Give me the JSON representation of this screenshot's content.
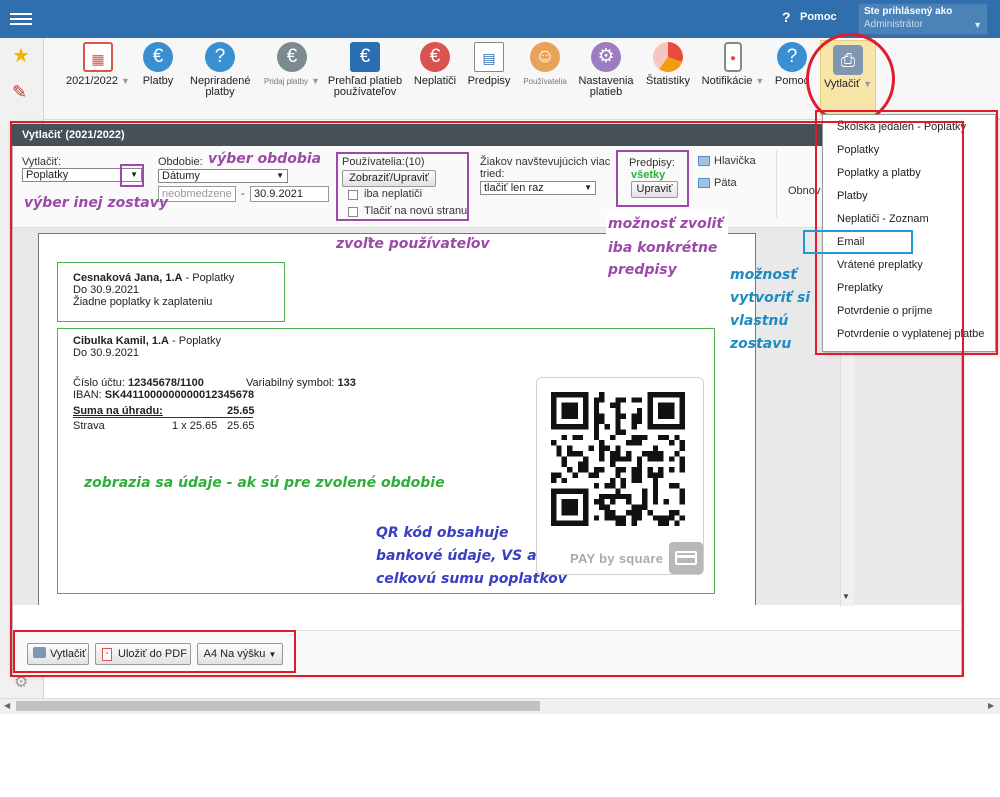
{
  "topbar": {
    "help": "Pomoc",
    "user_line1": "Ste prihlásený ako",
    "user_line2": "Administrátor"
  },
  "toolbar": {
    "items": [
      {
        "label": "2021/2022",
        "icon": "calendar-icon",
        "dropdown": true
      },
      {
        "label": "Platby",
        "icon": "money-bag-icon"
      },
      {
        "label": "Nepriradené platby",
        "icon": "question-money-bag-icon"
      },
      {
        "label": "Pridaj platby",
        "icon": "add-money-bag-icon",
        "dropdown": true
      },
      {
        "label": "Prehľad platieb používateľov",
        "icon": "ledger-icon"
      },
      {
        "label": "Neplatiči",
        "icon": "debtor-icon"
      },
      {
        "label": "Predpisy",
        "icon": "document-icon"
      },
      {
        "label": "Používatelia",
        "icon": "user-icon"
      },
      {
        "label": "Nastavenia platieb",
        "icon": "settings-gear-icon"
      },
      {
        "label": "Štatistiky",
        "icon": "pie-chart-icon"
      },
      {
        "label": "Notifikácie",
        "icon": "phone-icon",
        "dropdown": true
      },
      {
        "label": "Pomoc",
        "icon": "help-icon"
      },
      {
        "label": "Vytlačiť",
        "icon": "printer-icon",
        "dropdown": true
      }
    ]
  },
  "modal": {
    "title": "Vytlačiť (2021/2022)",
    "print_label": "Vytlačiť:",
    "print_value": "Poplatky",
    "period_label": "Obdobie:",
    "period_value": "Dátumy",
    "date_from_placeholder": "neobmedzene",
    "date_sep": "-",
    "date_to": "30.9.2021",
    "users_label": "Používatelia:(10)",
    "users_button": "Zobraziť/Upraviť",
    "only_debtors": "iba neplatiči",
    "print_new_page": "Tlačiť na novú stranu",
    "students_label": "Žiakov navštevujúcich viac tried:",
    "students_value": "tlačiť len raz",
    "predpisy_label": "Predpisy:",
    "predpisy_value": "všetky",
    "predpisy_button": "Upraviť",
    "header_label": "Hlavička",
    "footer_label": "Päta",
    "refresh_label": "Obnov"
  },
  "preview": {
    "card1": {
      "name": "Cesnaková Jana, 1.A",
      "suffix": " - Poplatky",
      "date": "Do 30.9.2021",
      "note": "Žiadne poplatky k zaplateniu"
    },
    "card2": {
      "name": "Cibulka Kamil, 1.A",
      "suffix": " - Poplatky",
      "date": "Do 30.9.2021",
      "account_label": "Číslo účtu:",
      "account": "12345678/1100",
      "vs_label": "Variabilný symbol:",
      "vs": "133",
      "iban_label": "IBAN:",
      "iban": "SK4411000000000012345678",
      "sum_label": "Suma na úhradu:",
      "sum": "25.65",
      "item": "Strava",
      "item_qty": "1 x 25.65",
      "item_amount": "25.65"
    },
    "qr_brand": "PAY by square"
  },
  "footer": {
    "print": "Vytlačiť",
    "pdf": "Uložiť do PDF",
    "format": "A4 Na výšku"
  },
  "dropdown": {
    "items": [
      "Školská jedáleň - Poplatky",
      "Poplatky",
      "Poplatky a platby",
      "Platby",
      "Neplatiči - Zoznam",
      "Email",
      "Vrátené preplatky",
      "Preplatky",
      "Potvrdenie o príjme",
      "Potvrdenie o vyplatenej platbe"
    ]
  },
  "annotations": {
    "select_report": "výber inej zostavy",
    "select_period": "výber obdobia",
    "choose_users": "zvoľte používateľov",
    "choose_predpisy_1": "možnosť zvoliť",
    "choose_predpisy_2": "iba konkrétne",
    "choose_predpisy_3": "predpisy",
    "custom_1": "možnosť",
    "custom_2": "vytvoriť si",
    "custom_3": "vlastnú",
    "custom_4": "zostavu",
    "data_shown": "zobrazia sa údaje - ak sú pre zvolené obdobie",
    "qr_1": "QR kód obsahuje",
    "qr_2": "bankové údaje, VS a",
    "qr_3": "celkovú sumu poplatkov"
  },
  "colors": {
    "topbar": "#2f6fad",
    "annotation_red": "#e21b2c",
    "annotation_purple": "#9b4aa7",
    "annotation_green": "#2fae3a",
    "annotation_blue": "#3a3fbf",
    "annotation_teal": "#1e8bc1"
  }
}
